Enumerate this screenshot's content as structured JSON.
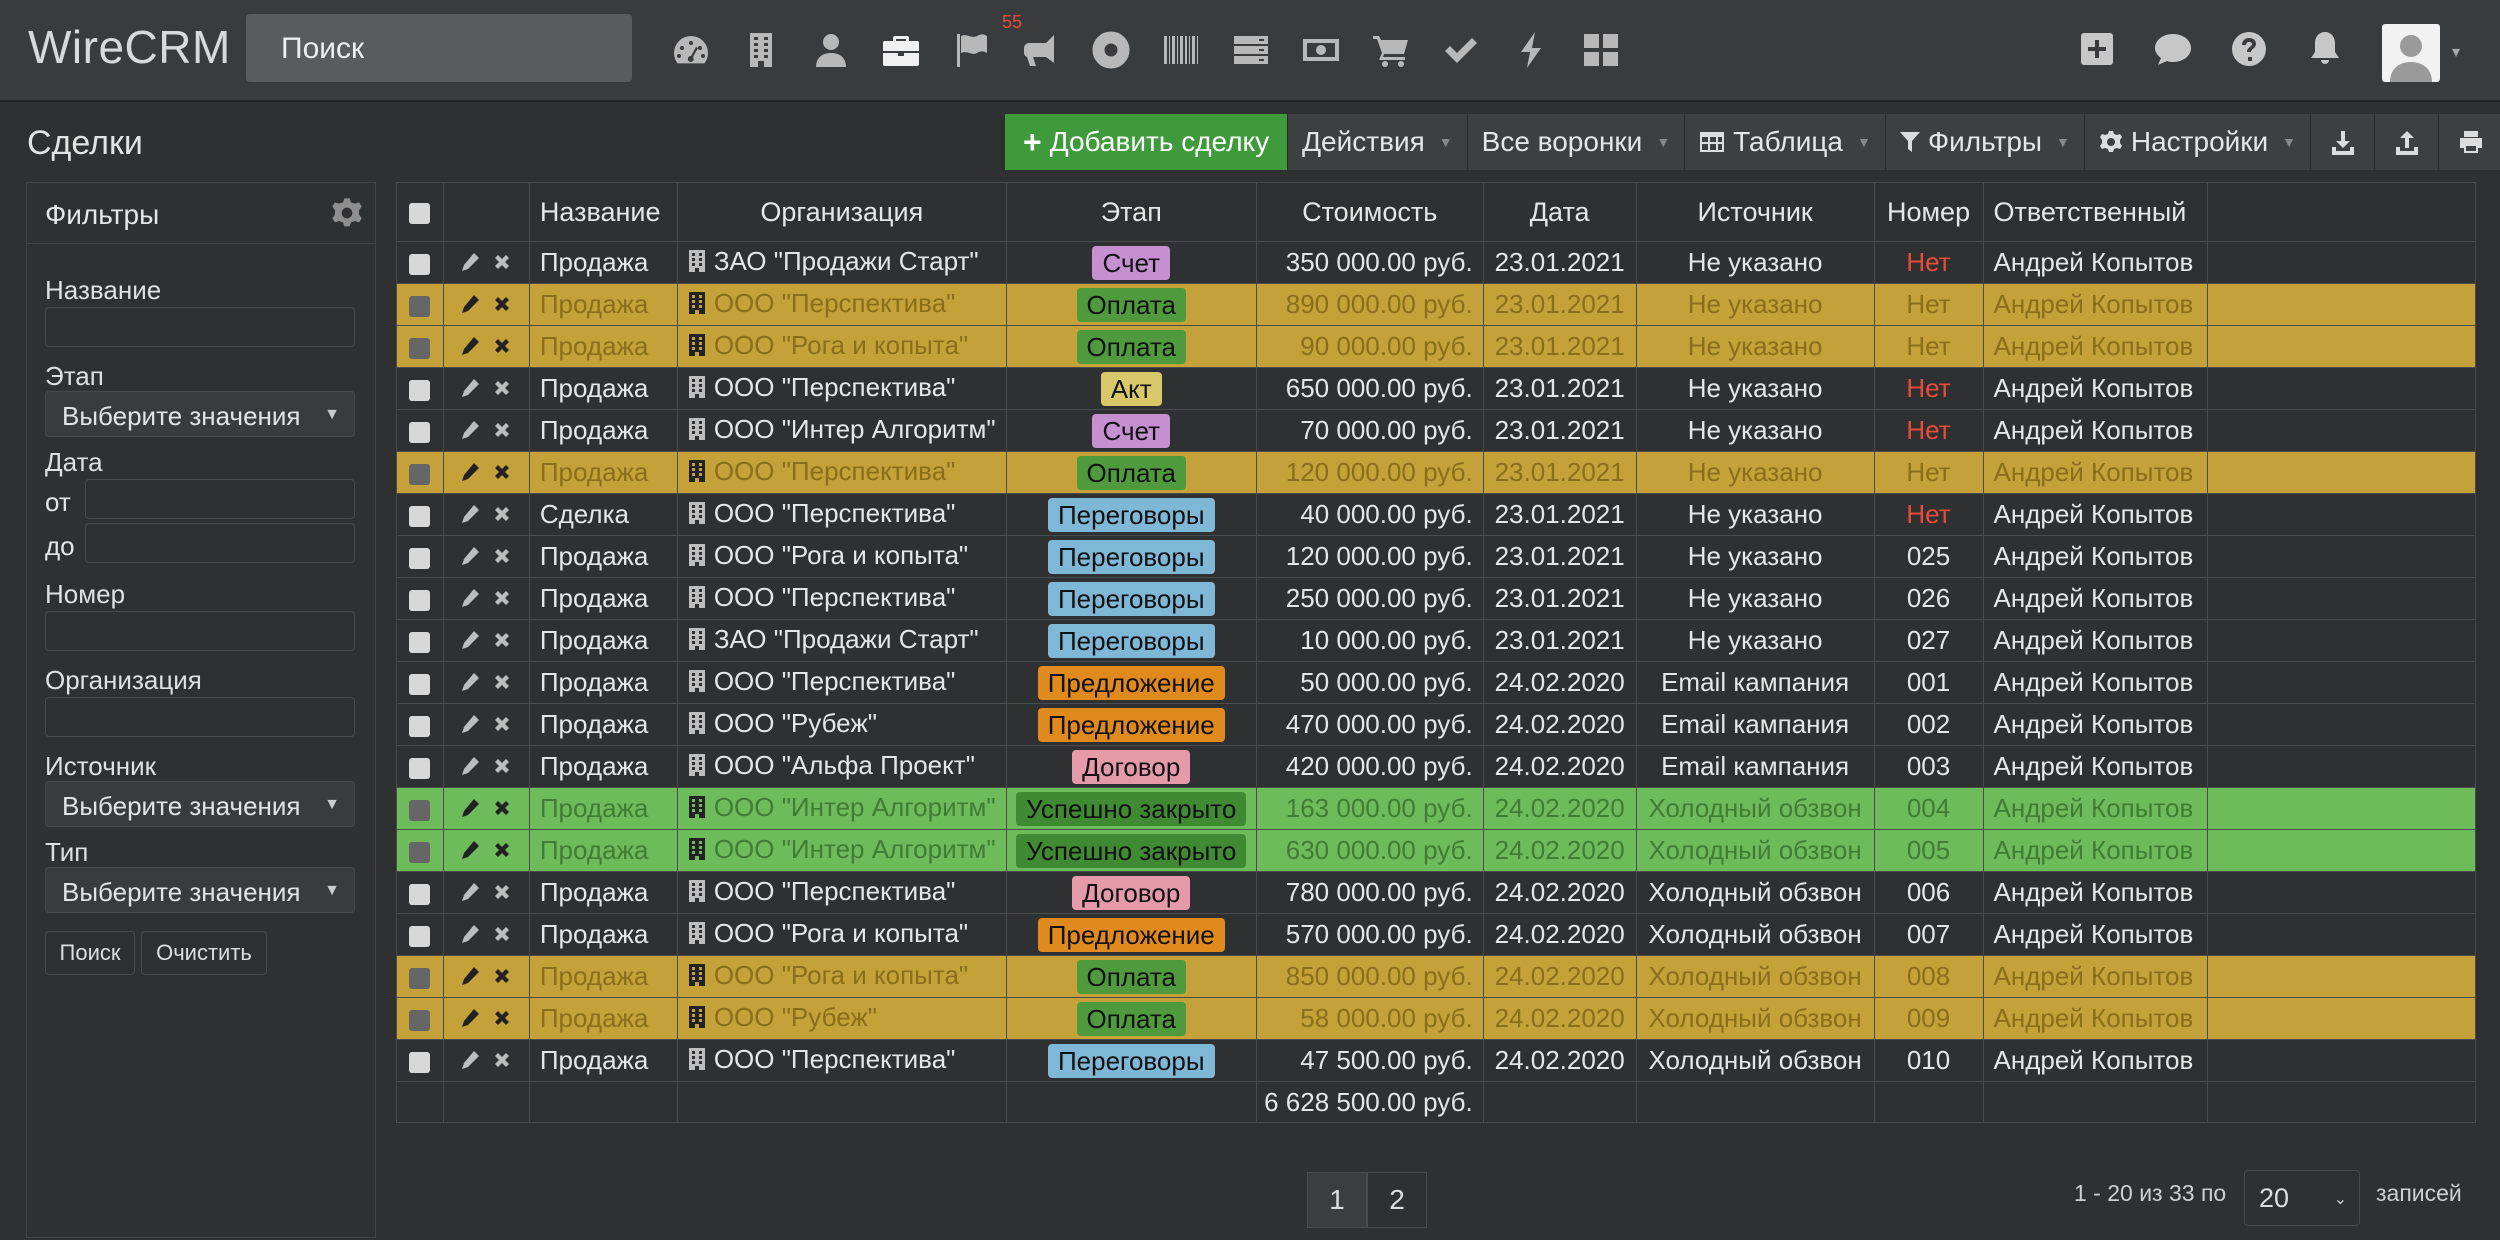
{
  "app": {
    "brand": "WireCRM",
    "search_placeholder": "Поиск"
  },
  "nav": {
    "icons": [
      "dashboard-icon",
      "building-icon",
      "user-icon",
      "briefcase-icon",
      "flag-icon",
      "megaphone-icon",
      "lifebuoy-icon",
      "barcode-icon",
      "server-icon",
      "money-icon",
      "cart-icon",
      "check-icon",
      "bolt-icon",
      "grid-icon"
    ],
    "active": "briefcase-icon",
    "flag_badge": "55",
    "right_icons": [
      "plus-square-icon",
      "comment-icon",
      "question-icon",
      "bell-icon"
    ]
  },
  "page": {
    "title": "Сделки"
  },
  "toolbar": {
    "add_label": "Добавить сделку",
    "actions_label": "Действия",
    "funnels_label": "Все воронки",
    "table_label": "Таблица",
    "filters_label": "Фильтры",
    "settings_label": "Настройки"
  },
  "filters": {
    "title": "Фильтры",
    "name_label": "Название",
    "stage_label": "Этап",
    "stage_placeholder": "Выберите значения",
    "date_label": "Дата",
    "from_label": "от",
    "to_label": "до",
    "number_label": "Номер",
    "org_label": "Организация",
    "source_label": "Источник",
    "source_placeholder": "Выберите значения",
    "type_label": "Тип",
    "type_placeholder": "Выберите значения",
    "search_btn": "Поиск",
    "clear_btn": "Очистить"
  },
  "table": {
    "columns": [
      "Название",
      "Организация",
      "Этап",
      "Стоимость",
      "Дата",
      "Источник",
      "Номер",
      "Ответственный"
    ],
    "stage_colors": {
      "Счет": "#c58fd0",
      "Оплата": "#4e9a3c",
      "Акт": "#d8c86a",
      "Переговоры": "#7fb7d6",
      "Предложение": "#e08a1e",
      "Договор": "#e59aaa",
      "Успешно закрыто": "#3f8a33"
    },
    "rows": [
      {
        "name": "Продажа",
        "org": "ЗАО \"Продажи Старт\"",
        "stage": "Счет",
        "cost": "350 000.00 руб.",
        "date": "23.01.2021",
        "source": "Не указано",
        "number": "Нет",
        "owner": "Андрей Копытов",
        "hl": ""
      },
      {
        "name": "Продажа",
        "org": "ООО \"Перспектива\"",
        "stage": "Оплата",
        "cost": "890 000.00 руб.",
        "date": "23.01.2021",
        "source": "Не указано",
        "number": "Нет",
        "owner": "Андрей Копытов",
        "hl": "y"
      },
      {
        "name": "Продажа",
        "org": "ООО \"Рога и копыта\"",
        "stage": "Оплата",
        "cost": "90 000.00 руб.",
        "date": "23.01.2021",
        "source": "Не указано",
        "number": "Нет",
        "owner": "Андрей Копытов",
        "hl": "y"
      },
      {
        "name": "Продажа",
        "org": "ООО \"Перспектива\"",
        "stage": "Акт",
        "cost": "650 000.00 руб.",
        "date": "23.01.2021",
        "source": "Не указано",
        "number": "Нет",
        "owner": "Андрей Копытов",
        "hl": ""
      },
      {
        "name": "Продажа",
        "org": "ООО \"Интер Алгоритм\"",
        "stage": "Счет",
        "cost": "70 000.00 руб.",
        "date": "23.01.2021",
        "source": "Не указано",
        "number": "Нет",
        "owner": "Андрей Копытов",
        "hl": ""
      },
      {
        "name": "Продажа",
        "org": "ООО \"Перспектива\"",
        "stage": "Оплата",
        "cost": "120 000.00 руб.",
        "date": "23.01.2021",
        "source": "Не указано",
        "number": "Нет",
        "owner": "Андрей Копытов",
        "hl": "y"
      },
      {
        "name": "Сделка",
        "org": "ООО \"Перспектива\"",
        "stage": "Переговоры",
        "cost": "40 000.00 руб.",
        "date": "23.01.2021",
        "source": "Не указано",
        "number": "Нет",
        "owner": "Андрей Копытов",
        "hl": ""
      },
      {
        "name": "Продажа",
        "org": "ООО \"Рога и копыта\"",
        "stage": "Переговоры",
        "cost": "120 000.00 руб.",
        "date": "23.01.2021",
        "source": "Не указано",
        "number": "025",
        "owner": "Андрей Копытов",
        "hl": ""
      },
      {
        "name": "Продажа",
        "org": "ООО \"Перспектива\"",
        "stage": "Переговоры",
        "cost": "250 000.00 руб.",
        "date": "23.01.2021",
        "source": "Не указано",
        "number": "026",
        "owner": "Андрей Копытов",
        "hl": ""
      },
      {
        "name": "Продажа",
        "org": "ЗАО \"Продажи Старт\"",
        "stage": "Переговоры",
        "cost": "10 000.00 руб.",
        "date": "23.01.2021",
        "source": "Не указано",
        "number": "027",
        "owner": "Андрей Копытов",
        "hl": ""
      },
      {
        "name": "Продажа",
        "org": "ООО \"Перспектива\"",
        "stage": "Предложение",
        "cost": "50 000.00 руб.",
        "date": "24.02.2020",
        "source": "Email кампания",
        "number": "001",
        "owner": "Андрей Копытов",
        "hl": ""
      },
      {
        "name": "Продажа",
        "org": "ООО \"Рубеж\"",
        "stage": "Предложение",
        "cost": "470 000.00 руб.",
        "date": "24.02.2020",
        "source": "Email кампания",
        "number": "002",
        "owner": "Андрей Копытов",
        "hl": ""
      },
      {
        "name": "Продажа",
        "org": "ООО \"Альфа Проект\"",
        "stage": "Договор",
        "cost": "420 000.00 руб.",
        "date": "24.02.2020",
        "source": "Email кампания",
        "number": "003",
        "owner": "Андрей Копытов",
        "hl": ""
      },
      {
        "name": "Продажа",
        "org": "ООО \"Интер Алгоритм\"",
        "stage": "Успешно закрыто",
        "cost": "163 000.00 руб.",
        "date": "24.02.2020",
        "source": "Холодный обзвон",
        "number": "004",
        "owner": "Андрей Копытов",
        "hl": "g"
      },
      {
        "name": "Продажа",
        "org": "ООО \"Интер Алгоритм\"",
        "stage": "Успешно закрыто",
        "cost": "630 000.00 руб.",
        "date": "24.02.2020",
        "source": "Холодный обзвон",
        "number": "005",
        "owner": "Андрей Копытов",
        "hl": "g"
      },
      {
        "name": "Продажа",
        "org": "ООО \"Перспектива\"",
        "stage": "Договор",
        "cost": "780 000.00 руб.",
        "date": "24.02.2020",
        "source": "Холодный обзвон",
        "number": "006",
        "owner": "Андрей Копытов",
        "hl": ""
      },
      {
        "name": "Продажа",
        "org": "ООО \"Рога и копыта\"",
        "stage": "Предложение",
        "cost": "570 000.00 руб.",
        "date": "24.02.2020",
        "source": "Холодный обзвон",
        "number": "007",
        "owner": "Андрей Копытов",
        "hl": ""
      },
      {
        "name": "Продажа",
        "org": "ООО \"Рога и копыта\"",
        "stage": "Оплата",
        "cost": "850 000.00 руб.",
        "date": "24.02.2020",
        "source": "Холодный обзвон",
        "number": "008",
        "owner": "Андрей Копытов",
        "hl": "y"
      },
      {
        "name": "Продажа",
        "org": "ООО \"Рубеж\"",
        "stage": "Оплата",
        "cost": "58 000.00 руб.",
        "date": "24.02.2020",
        "source": "Холодный обзвон",
        "number": "009",
        "owner": "Андрей Копытов",
        "hl": "y"
      },
      {
        "name": "Продажа",
        "org": "ООО \"Перспектива\"",
        "stage": "Переговоры",
        "cost": "47 500.00 руб.",
        "date": "24.02.2020",
        "source": "Холодный обзвон",
        "number": "010",
        "owner": "Андрей Копытов",
        "hl": ""
      }
    ],
    "total": "6 628 500.00 руб."
  },
  "pagination": {
    "pages": [
      "1",
      "2"
    ],
    "active_page": "1",
    "info": "1 - 20 из 33 по",
    "page_size": "20",
    "suffix": "записей"
  }
}
